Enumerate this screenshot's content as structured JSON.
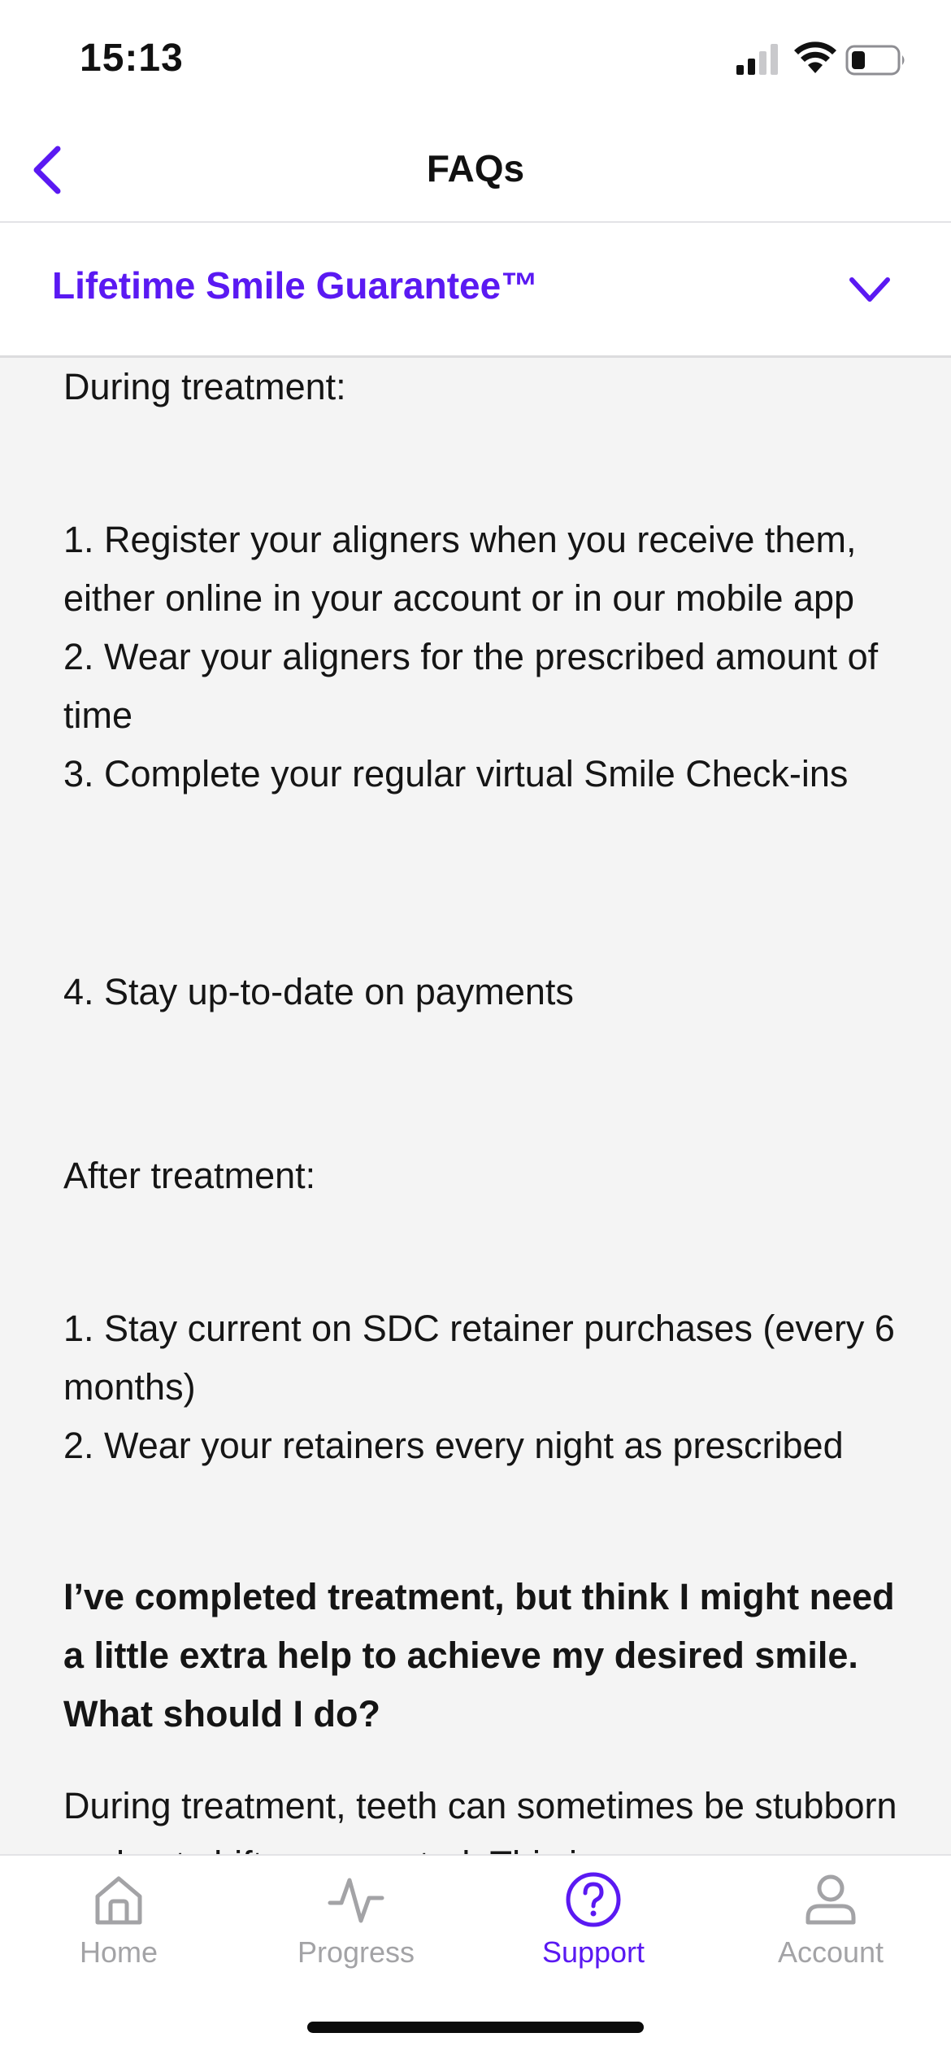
{
  "status_bar": {
    "time": "15:13",
    "icons": [
      "cellular-signal-icon",
      "wifi-icon",
      "battery-icon"
    ]
  },
  "nav": {
    "title": "FAQs",
    "back_icon": "chevron-left-icon"
  },
  "accordion": {
    "title": "Lifetime Smile Guarantee™",
    "chevron_icon": "chevron-down-icon",
    "expanded": true
  },
  "content": {
    "during_heading": "During treatment:",
    "during_items_a": "1. Register your aligners when you receive them, either online in your account or in our mobile app\n2. Wear your aligners for the prescribed amount of time\n3. Complete your regular virtual Smile Check-ins",
    "during_item_4": "4. Stay up-to-date on payments",
    "after_heading": "After treatment:",
    "after_items": "1. Stay current on SDC retainer purchases (every 6 months)\n2. Wear your retainers every night as prescribed",
    "question": "I’ve completed treatment, but think I might need a little extra help to achieve my desired smile. What should I do?",
    "answer": "During treatment, teeth can sometimes be stubborn and not shift as expected. This is"
  },
  "tab_bar": {
    "tabs": [
      {
        "label": "Home",
        "icon": "home-icon",
        "active": false
      },
      {
        "label": "Progress",
        "icon": "activity-icon",
        "active": false
      },
      {
        "label": "Support",
        "icon": "help-circle-icon",
        "active": true
      },
      {
        "label": "Account",
        "icon": "user-icon",
        "active": false
      }
    ]
  },
  "colors": {
    "accent": "#5a19f2",
    "inactive": "#a3a3a6",
    "content_bg": "#f4f4f4"
  }
}
